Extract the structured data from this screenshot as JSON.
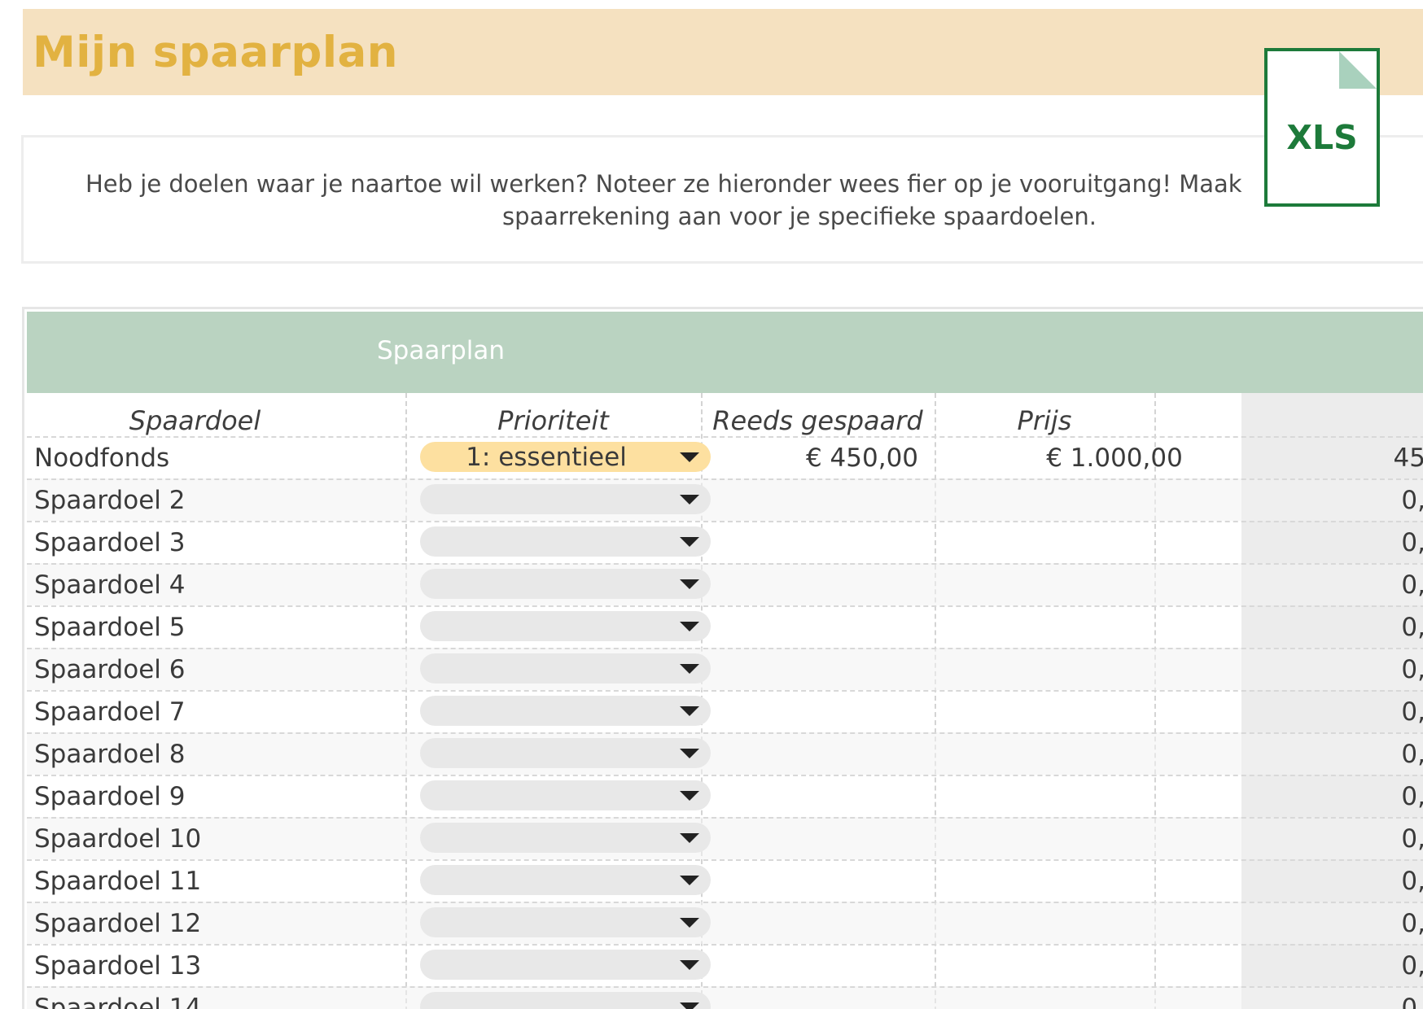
{
  "page": {
    "title": "Mijn spaarplan"
  },
  "intro": {
    "line1": "Heb je doelen waar je naartoe wil werken? Noteer ze hieronder wees fier op je vooruitgang! Maak",
    "line2": "spaarrekening aan voor je specifieke spaardoelen."
  },
  "badge": {
    "label": "XLS",
    "icon": "excel-file-icon",
    "color": "#1d7a3a"
  },
  "table": {
    "title": "Spaarplan",
    "columns": {
      "goal": "Spaardoel",
      "priority": "Prioriteit",
      "saved": "Reeds gespaard",
      "price": "Prijs",
      "progress": ""
    },
    "rows": [
      {
        "goal": "Noodfonds",
        "priority": "1: essentieel",
        "saved": "€ 450,00",
        "price": "€ 1.000,00",
        "progress": "45"
      },
      {
        "goal": "Spaardoel 2",
        "priority": "",
        "saved": "",
        "price": "",
        "progress": "0,"
      },
      {
        "goal": "Spaardoel 3",
        "priority": "",
        "saved": "",
        "price": "",
        "progress": "0,"
      },
      {
        "goal": "Spaardoel 4",
        "priority": "",
        "saved": "",
        "price": "",
        "progress": "0,"
      },
      {
        "goal": "Spaardoel 5",
        "priority": "",
        "saved": "",
        "price": "",
        "progress": "0,"
      },
      {
        "goal": "Spaardoel 6",
        "priority": "",
        "saved": "",
        "price": "",
        "progress": "0,"
      },
      {
        "goal": "Spaardoel 7",
        "priority": "",
        "saved": "",
        "price": "",
        "progress": "0,"
      },
      {
        "goal": "Spaardoel 8",
        "priority": "",
        "saved": "",
        "price": "",
        "progress": "0,"
      },
      {
        "goal": "Spaardoel 9",
        "priority": "",
        "saved": "",
        "price": "",
        "progress": "0,"
      },
      {
        "goal": "Spaardoel 10",
        "priority": "",
        "saved": "",
        "price": "",
        "progress": "0,"
      },
      {
        "goal": "Spaardoel 11",
        "priority": "",
        "saved": "",
        "price": "",
        "progress": "0,"
      },
      {
        "goal": "Spaardoel 12",
        "priority": "",
        "saved": "",
        "price": "",
        "progress": "0,"
      },
      {
        "goal": "Spaardoel 13",
        "priority": "",
        "saved": "",
        "price": "",
        "progress": "0,"
      },
      {
        "goal": "Spaardoel 14",
        "priority": "",
        "saved": "",
        "price": "",
        "progress": "0,"
      }
    ]
  },
  "colors": {
    "title_bg": "#f5e1c0",
    "title_text": "#e2b241",
    "table_header_bg": "#bad3c1",
    "priority_filled": "#fde0a0",
    "priority_empty": "#e8e8e8"
  }
}
